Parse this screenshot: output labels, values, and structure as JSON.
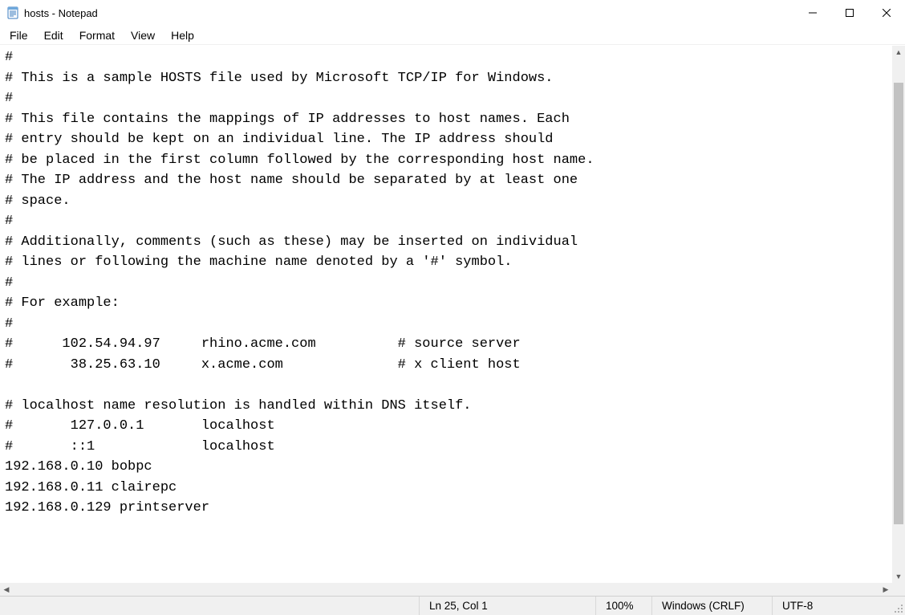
{
  "window": {
    "title": "hosts - Notepad"
  },
  "menus": [
    "File",
    "Edit",
    "Format",
    "View",
    "Help"
  ],
  "editor": {
    "text": "#\n# This is a sample HOSTS file used by Microsoft TCP/IP for Windows.\n#\n# This file contains the mappings of IP addresses to host names. Each\n# entry should be kept on an individual line. The IP address should\n# be placed in the first column followed by the corresponding host name.\n# The IP address and the host name should be separated by at least one\n# space.\n#\n# Additionally, comments (such as these) may be inserted on individual\n# lines or following the machine name denoted by a '#' symbol.\n#\n# For example:\n#\n#      102.54.94.97     rhino.acme.com          # source server\n#       38.25.63.10     x.acme.com              # x client host\n\n# localhost name resolution is handled within DNS itself.\n#\t127.0.0.1       localhost\n#\t::1             localhost\n192.168.0.10 bobpc\n192.168.0.11 clairepc\n192.168.0.129 printserver\n"
  },
  "status": {
    "position": "Ln 25, Col 1",
    "zoom": "100%",
    "lineEnding": "Windows (CRLF)",
    "encoding": "UTF-8"
  }
}
